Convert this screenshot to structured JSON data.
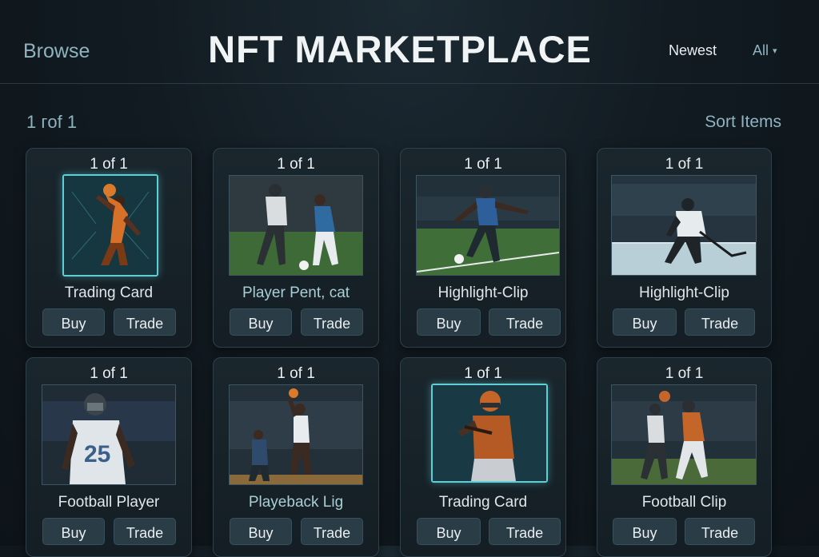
{
  "header": {
    "browse_label": "Browse",
    "title": "NFT MARKETPLACE",
    "sort_newest": "Newest",
    "filter_all": "All",
    "filter_caret": "▾"
  },
  "subheader": {
    "count_text": "1 ᴦof 1",
    "sort_label": "Sort Items"
  },
  "cards": [
    {
      "edition": "1 of 1",
      "label": "Trading Card",
      "buy": "Buy",
      "trade": "Trade"
    },
    {
      "edition": "1 of 1",
      "label": "Player Pent, cat",
      "buy": "Buy",
      "trade": "Trade"
    },
    {
      "edition": "1 of 1",
      "label": "Highlight-Clip",
      "buy": "Buy",
      "trade": "Trade"
    },
    {
      "edition": "1 of 1",
      "label": "Highlight-Clip",
      "buy": "Buy",
      "trade": "Trade"
    },
    {
      "edition": "1 of 1",
      "label": "Football Player",
      "buy": "Buy",
      "trade": "Trade"
    },
    {
      "edition": "1 of 1",
      "label": "Playeback Lig",
      "buy": "Buy",
      "trade": "Trade"
    },
    {
      "edition": "1 of 1",
      "label": "Trading Card",
      "buy": "Buy",
      "trade": "Trade"
    },
    {
      "edition": "1 of 1",
      "label": "Football Clip",
      "buy": "Buy",
      "trade": "Trade"
    }
  ],
  "colors": {
    "accent_teal": "#5ecfd6",
    "muted_teal": "#8fb3bf",
    "card_bg": "#1a262d",
    "button_bg": "#2a3c46"
  }
}
